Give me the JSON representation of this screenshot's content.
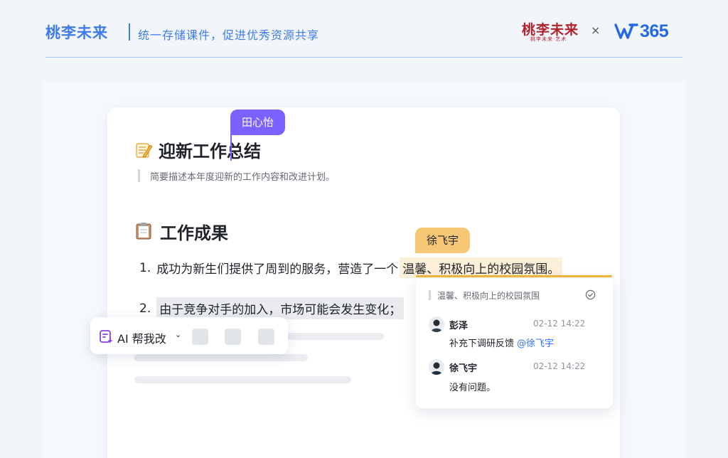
{
  "header": {
    "brand": "桃李未来",
    "slogan": "统一存储课件，促进优秀资源共享",
    "partner_logo_text": "桃李未来",
    "partner_logo_sub": "桃李未来·艺术",
    "times_sign": "×",
    "w365_num": "365"
  },
  "doc": {
    "title_icon": "memo-icon",
    "title": "迎新工作总结",
    "description": "简要描述本年度迎新的工作内容和改进计划。",
    "section_icon": "clipboard-icon",
    "section_title": "工作成果",
    "items": [
      {
        "num": "1.",
        "text": "成功为新生们提供了周到的服务，营造了一个",
        "highlight": "温馨、积极向上的校园氛围。"
      },
      {
        "num": "2.",
        "text": "由于竞争对手的加入，市场可能会发生变化；"
      }
    ]
  },
  "collaborators": {
    "cursor_user": "田心怡",
    "comment_user": "徐飞宇"
  },
  "comment": {
    "quote": "温馨、积极向上的校园氛围",
    "entries": [
      {
        "name": "彭泽",
        "time": "02-12 14:22",
        "text": "补充下调研反馈",
        "mention": "@徐飞宇"
      },
      {
        "name": "徐飞宇",
        "time": "02-12 14:22",
        "text": "没有问题。"
      }
    ]
  },
  "ai_toolbar": {
    "label": "AI 帮我改",
    "caret": "⌄"
  },
  "colors": {
    "brand_blue": "#3f7bea",
    "cursor_purple": "#7b61ff",
    "comment_orange": "#f8c776",
    "mention_blue": "#3370ff"
  }
}
